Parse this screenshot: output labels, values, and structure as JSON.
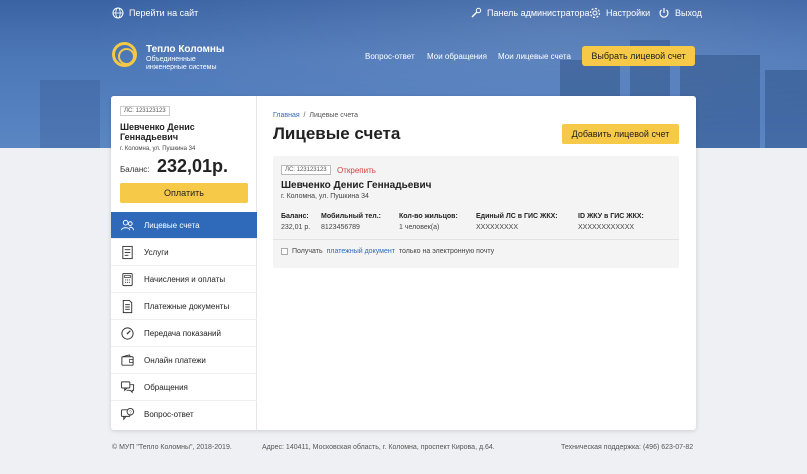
{
  "topbar": {
    "goto_site": "Перейти на сайт",
    "admin_panel": "Панель администратора",
    "settings": "Настройки",
    "logout": "Выход"
  },
  "brand": {
    "title": "Тепло Коломны",
    "subtitle": "Объединенные инженерные системы"
  },
  "nav": {
    "faq": "Вопрос-ответ",
    "requests": "Мои обращения",
    "accounts": "Мои лицевые счета",
    "choose_account": "Выбрать лицевой счет"
  },
  "sidebar": {
    "ls_badge": "ЛС: 123123123",
    "name": "Шевченко Денис Геннадьевич",
    "address": "г. Коломна, ул. Пушкина 34",
    "balance_label": "Баланс:",
    "balance_value": "232,01р.",
    "pay_button": "Оплатить",
    "items": [
      {
        "label": "Лицевые счета",
        "icon": "users-icon"
      },
      {
        "label": "Услуги",
        "icon": "document-icon"
      },
      {
        "label": "Начисления и оплаты",
        "icon": "calculator-icon"
      },
      {
        "label": "Платежные документы",
        "icon": "invoice-icon"
      },
      {
        "label": "Передача показаний",
        "icon": "gauge-icon"
      },
      {
        "label": "Онлайн платежи",
        "icon": "wallet-icon"
      },
      {
        "label": "Обращения",
        "icon": "chat-icon"
      },
      {
        "label": "Вопрос-ответ",
        "icon": "question-icon"
      }
    ]
  },
  "content": {
    "breadcrumb_home": "Главная",
    "breadcrumb_sep": "/",
    "breadcrumb_current": "Лицевые счета",
    "title": "Лицевые счета",
    "add_button": "Добавить лицевой счет"
  },
  "account": {
    "ls_badge": "ЛС: 123123123",
    "unpin": "Открепить",
    "name": "Шевченко Денис Геннадьевич",
    "address": "г. Коломна, ул. Пушкина 34",
    "columns": [
      {
        "header": "Баланс:",
        "value": "232,01 р."
      },
      {
        "header": "Мобильный тел.:",
        "value": "8123456789"
      },
      {
        "header": "Кол-во жильцов:",
        "value": "1 человек(а)"
      },
      {
        "header": "Единый ЛС в ГИС ЖКХ:",
        "value": "XXXXXXXXX"
      },
      {
        "header": "ID ЖКУ в ГИС ЖКХ:",
        "value": "XXXXXXXXXXXX"
      }
    ],
    "checkbox_pre": "Получать",
    "checkbox_link": "платежный документ",
    "checkbox_post": "только на электронную почту",
    "checkbox_checked": false
  },
  "footer": {
    "copyright": "© МУП \"Тепло Коломны\", 2018-2019.",
    "address": "Адрес: 140411, Московская область, г. Коломна, проспект Кирова, д.64.",
    "support": "Техническая поддержка: (496) 623-07-82"
  },
  "colors": {
    "accent": "#2f69ba",
    "button": "#f7c948",
    "danger": "#d64040"
  }
}
